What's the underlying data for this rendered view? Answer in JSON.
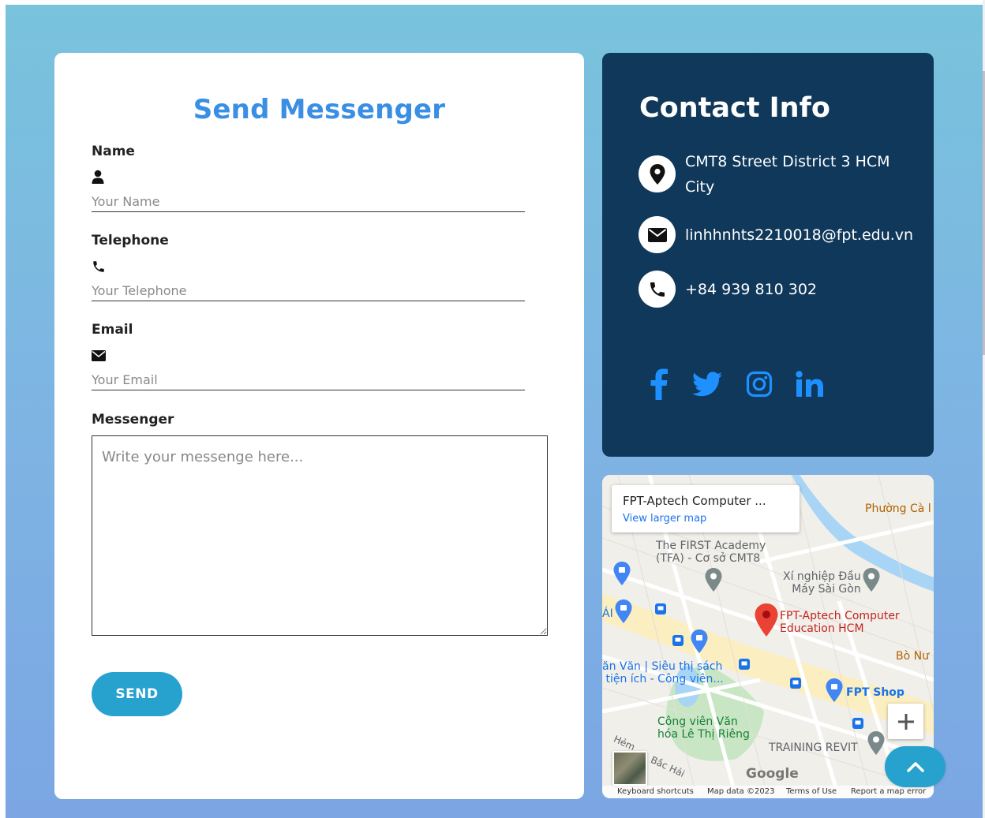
{
  "form": {
    "title": "Send Messenger",
    "name": {
      "label": "Name",
      "placeholder": "Your Name",
      "icon": "user-icon"
    },
    "telephone": {
      "label": "Telephone",
      "placeholder": "Your Telephone",
      "icon": "phone-icon"
    },
    "email": {
      "label": "Email",
      "placeholder": "Your Email",
      "icon": "envelope-icon"
    },
    "message": {
      "label": "Messenger",
      "placeholder": "Write your messenge here..."
    },
    "send_label": "SEND"
  },
  "contact": {
    "title": "Contact Info",
    "address": "CMT8 Street District 3 HCM City",
    "email": "linhhnhts2210018@fpt.edu.vn",
    "phone": "+84 939 810 302",
    "socials": [
      "facebook-icon",
      "twitter-icon",
      "instagram-icon",
      "linkedin-icon"
    ]
  },
  "map": {
    "card_title": "FPT-Aptech Computer ...",
    "card_link": "View larger map",
    "labels": {
      "first_academy": "The FIRST Academy\n(TFA) - Cơ sở CMT8",
      "xi_nghiep": "Xí nghiệp Đầu\nMáy Sài Gòn",
      "fpt_aptech": "FPT-Aptech Computer\nEducation HCM",
      "phuong_ca": "Phường Cà l",
      "bo_nu": "Bò Nư",
      "van_van": "ăn Văn | Siêu thị sách\n tiện ích - Công viên...",
      "fpt_shop": "FPT Shop",
      "cong_vien": "Công viên Văn\nhóa Lê Thị Riêng",
      "training_revit": "TRAINING REVIT",
      "bac_hai": "Bắc Hải",
      "hem": "Hẻm",
      "ai": "ÁI"
    },
    "google": "Google",
    "footer": {
      "shortcuts": "Keyboard shortcuts",
      "map_data": "Map data ©2023",
      "terms": "Terms of Use",
      "report": "Report a map error"
    }
  },
  "colors": {
    "title_blue": "#3a8ee3",
    "contact_bg": "#0f385a",
    "button": "#27a2cf",
    "social_blue": "#1e90ff"
  }
}
